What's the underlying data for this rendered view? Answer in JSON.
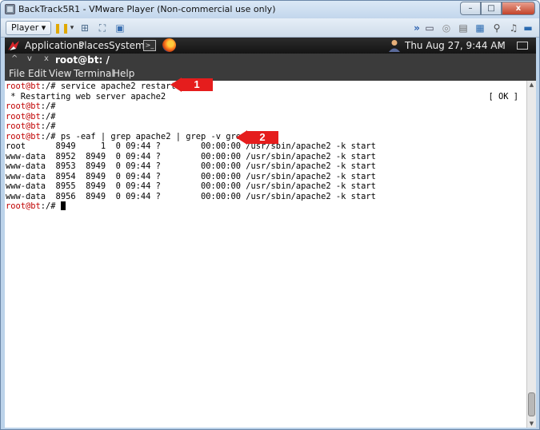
{
  "window": {
    "title": "BackTrack5R1 - VMware Player (Non-commercial use only)",
    "minimize": "–",
    "maximize": "□",
    "close": "x"
  },
  "vmware_toolbar": {
    "player_label": "Player",
    "player_arrow": "▾",
    "double_arrow": "»"
  },
  "gnome_panel": {
    "menus": [
      "Applications",
      "Places",
      "System"
    ],
    "clock": "Thu Aug 27,  9:44 AM",
    "speaker": "◁"
  },
  "terminal_window": {
    "tab_controls": [
      "^",
      "v",
      "x"
    ],
    "tab_title": "root@bt: /",
    "menus": [
      "File",
      "Edit",
      "View",
      "Terminal",
      "Help"
    ]
  },
  "terminal": {
    "lines": [
      {
        "prompt": "root@bt",
        "rest": ":/# service apache2 restart"
      },
      {
        "prompt": "",
        "rest": " * Restarting web server apache2",
        "right": "[ OK ]"
      },
      {
        "prompt": "root@bt",
        "rest": ":/#"
      },
      {
        "prompt": "root@bt",
        "rest": ":/#"
      },
      {
        "prompt": "root@bt",
        "rest": ":/#"
      },
      {
        "prompt": "root@bt",
        "rest": ":/# ps -eaf | grep apache2 | grep -v grep"
      },
      {
        "prompt": "",
        "rest": "root      8949     1  0 09:44 ?        00:00:00 /usr/sbin/apache2 -k start"
      },
      {
        "prompt": "",
        "rest": "www-data  8952  8949  0 09:44 ?        00:00:00 /usr/sbin/apache2 -k start"
      },
      {
        "prompt": "",
        "rest": "www-data  8953  8949  0 09:44 ?        00:00:00 /usr/sbin/apache2 -k start"
      },
      {
        "prompt": "",
        "rest": "www-data  8954  8949  0 09:44 ?        00:00:00 /usr/sbin/apache2 -k start"
      },
      {
        "prompt": "",
        "rest": "www-data  8955  8949  0 09:44 ?        00:00:00 /usr/sbin/apache2 -k start"
      },
      {
        "prompt": "",
        "rest": "www-data  8956  8949  0 09:44 ?        00:00:00 /usr/sbin/apache2 -k start"
      },
      {
        "prompt": "root@bt",
        "rest": ":/# "
      }
    ]
  },
  "callouts": [
    "1",
    "2"
  ],
  "colors": {
    "prompt": "#c00000",
    "callout": "#e51d1d",
    "panel": "#1e1e1e"
  }
}
